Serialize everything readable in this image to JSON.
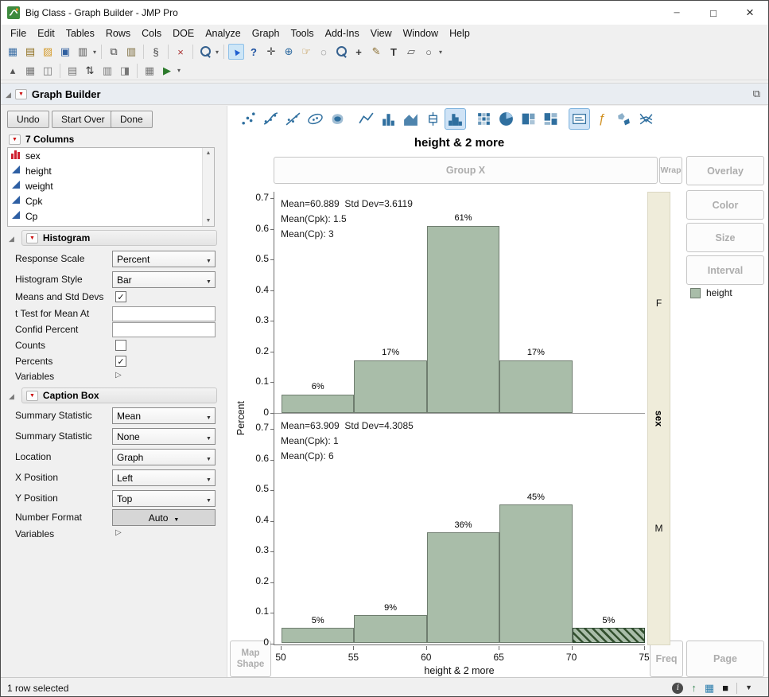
{
  "window": {
    "title": "Big Class - Graph Builder - JMP Pro"
  },
  "menu": [
    "File",
    "Edit",
    "Tables",
    "Rows",
    "Cols",
    "DOE",
    "Analyze",
    "Graph",
    "Tools",
    "Add-Ins",
    "View",
    "Window",
    "Help"
  ],
  "toolbars": {
    "row1": [
      "new-data-table",
      "new-journal",
      "open",
      "save",
      "print",
      "v",
      "|",
      "copy",
      "paste",
      "|",
      "edit-script",
      "|",
      "clear",
      "|",
      "search",
      "v",
      "|",
      "arrow-tool",
      "help-tool",
      "move-tool",
      "globe-t ool",
      "hand-tool",
      "lasso-tool",
      "magnifier-tool",
      "crosshair-tool",
      "pencil-tool",
      "text-annotate-tool",
      "polygon-tool",
      "oval-tool",
      "v"
    ],
    "row2": [
      "distribution-launcher",
      "data-table-view",
      "matrix-view",
      "|",
      "excluded-rows",
      "sort-ascending",
      "column-headers",
      "group-columns",
      "|",
      "table-summary",
      "run-script",
      "v"
    ]
  },
  "builder": {
    "header": "Graph Builder",
    "buttons": {
      "undo": "Undo",
      "start_over": "Start Over",
      "done": "Done"
    },
    "columns": {
      "title": "7 Columns",
      "items": [
        {
          "name": "sex",
          "type": "nominal"
        },
        {
          "name": "height",
          "type": "continuous"
        },
        {
          "name": "weight",
          "type": "continuous"
        },
        {
          "name": "Cpk",
          "type": "continuous"
        },
        {
          "name": "Cp",
          "type": "continuous"
        }
      ]
    },
    "histogram": {
      "title": "Histogram",
      "response_scale_label": "Response Scale",
      "response_scale_value": "Percent",
      "style_label": "Histogram Style",
      "style_value": "Bar",
      "means_label": "Means and Std Devs",
      "means_checked": true,
      "ttest_label": "t Test for Mean At",
      "ttest_value": "",
      "confid_label": "Confid Percent",
      "confid_value": "",
      "counts_label": "Counts",
      "counts_checked": false,
      "percents_label": "Percents",
      "percents_checked": true,
      "variables_label": "Variables"
    },
    "caption_box": {
      "title": "Caption Box",
      "stat1_label": "Summary Statistic",
      "stat1_value": "Mean",
      "stat2_label": "Summary Statistic",
      "stat2_value": "None",
      "location_label": "Location",
      "location_value": "Graph",
      "xpos_label": "X Position",
      "xpos_value": "Left",
      "ypos_label": "Y Position",
      "ypos_value": "Top",
      "numfmt_label": "Number Format",
      "numfmt_value": "Auto",
      "variables_label": "Variables"
    }
  },
  "graph": {
    "title": "height & 2 more",
    "xlabel": "height & 2 more",
    "ylabel": "Percent",
    "group_var": "sex",
    "zones": {
      "group_x": "Group X",
      "wrap": "Wrap",
      "overlay": "Overlay",
      "color": "Color",
      "size": "Size",
      "interval": "Interval",
      "freq": "Freq",
      "page": "Page",
      "map_shape": "Map Shape"
    },
    "legend": {
      "label": "height"
    },
    "colors": {
      "bar_fill": "#a9bda9",
      "bar_border": "#6f7d6f",
      "selection_hatch": "#33502f"
    },
    "palette": [
      {
        "name": "points"
      },
      {
        "name": "smoother"
      },
      {
        "name": "line-of-fit"
      },
      {
        "name": "ellipse"
      },
      {
        "name": "contour"
      },
      {
        "name": "line"
      },
      {
        "name": "bar"
      },
      {
        "name": "area"
      },
      {
        "name": "box-plot"
      },
      {
        "name": "histogram",
        "selected": true
      },
      {
        "name": "heatmap"
      },
      {
        "name": "pie"
      },
      {
        "name": "treemap"
      },
      {
        "name": "mosaic"
      },
      {
        "name": "caption-box",
        "selected": true
      },
      {
        "name": "formula"
      },
      {
        "name": "map-shapes"
      },
      {
        "name": "parallel"
      }
    ]
  },
  "chart_data": [
    {
      "type": "bar",
      "subtype": "histogram",
      "panel_label": "F",
      "title": "height & 2 more",
      "xlabel": "height & 2 more",
      "ylabel": "Percent",
      "caption_lines": [
        "Mean=60.889  Std Dev=3.6119",
        "Mean(Cpk): 1.5",
        "Mean(Cp): 3"
      ],
      "bins": [
        {
          "x0": 50,
          "x1": 55,
          "p": 0.06,
          "label": "6%"
        },
        {
          "x0": 55,
          "x1": 60,
          "p": 0.17,
          "label": "17%"
        },
        {
          "x0": 60,
          "x1": 65,
          "p": 0.61,
          "label": "61%"
        },
        {
          "x0": 65,
          "x1": 70,
          "p": 0.17,
          "label": "17%"
        }
      ],
      "ylim": [
        0,
        0.7
      ],
      "yticks": [
        0.7,
        0.6,
        0.5,
        0.4,
        0.3,
        0.2,
        0.1,
        0
      ]
    },
    {
      "type": "bar",
      "subtype": "histogram",
      "panel_label": "M",
      "title": "height & 2 more",
      "xlabel": "height & 2 more",
      "ylabel": "Percent",
      "caption_lines": [
        "Mean=63.909  Std Dev=4.3085",
        "Mean(Cpk): 1",
        "Mean(Cp): 6"
      ],
      "bins": [
        {
          "x0": 50,
          "x1": 55,
          "p": 0.05,
          "label": "5%"
        },
        {
          "x0": 55,
          "x1": 60,
          "p": 0.09,
          "label": "9%"
        },
        {
          "x0": 60,
          "x1": 65,
          "p": 0.36,
          "label": "36%"
        },
        {
          "x0": 65,
          "x1": 70,
          "p": 0.45,
          "label": "45%"
        },
        {
          "x0": 70,
          "x1": 75,
          "p": 0.05,
          "label": "5%",
          "selected": true
        }
      ],
      "ylim": [
        0,
        0.7
      ],
      "yticks": [
        0.7,
        0.6,
        0.5,
        0.4,
        0.3,
        0.2,
        0.1,
        0
      ],
      "xlim": [
        50,
        75
      ],
      "xticks": [
        50,
        55,
        60,
        65,
        70,
        75
      ]
    }
  ],
  "status": {
    "text": "1 row selected"
  }
}
